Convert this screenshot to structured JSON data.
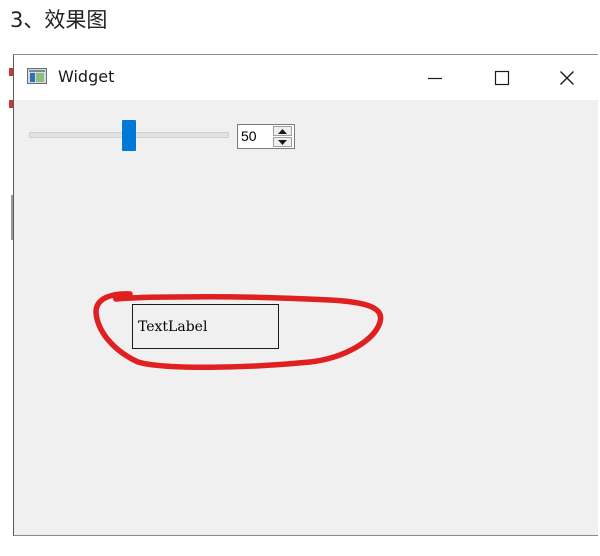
{
  "heading": "3、效果图",
  "window": {
    "title": "Widget",
    "icons": {
      "app": "app-window-icon",
      "minimize": "minimize-icon",
      "maximize": "maximize-icon",
      "close": "close-icon"
    }
  },
  "slider": {
    "value": 50,
    "min": 0,
    "max": 100,
    "accent": "#0078d7"
  },
  "spinbox": {
    "value": "50",
    "icons": {
      "up": "arrow-up-icon",
      "down": "arrow-down-icon"
    }
  },
  "label": {
    "text": "TextLabel"
  },
  "annotation": {
    "color": "#e02020",
    "shape": "hand-drawn-circle"
  }
}
